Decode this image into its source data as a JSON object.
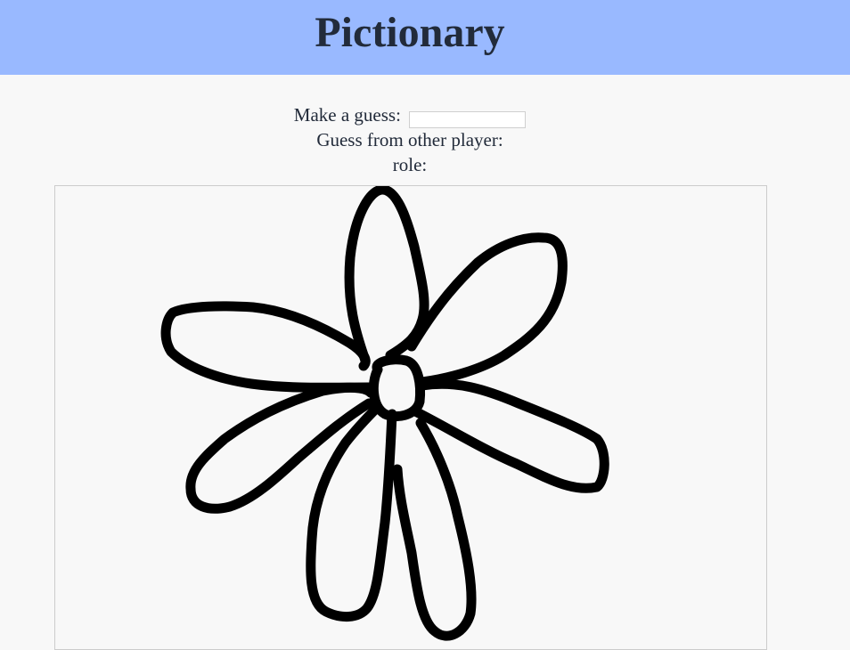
{
  "header": {
    "title": "Pictionary"
  },
  "guess": {
    "label": "Make a guess:",
    "value": "",
    "placeholder": ""
  },
  "other_player": {
    "label": "Guess from other player:",
    "value": ""
  },
  "role": {
    "label": "role:",
    "value": ""
  },
  "colors": {
    "header_bg": "#99b9ff",
    "page_bg": "#f8f8f8",
    "stroke": "#000000",
    "text": "#222b3a"
  }
}
